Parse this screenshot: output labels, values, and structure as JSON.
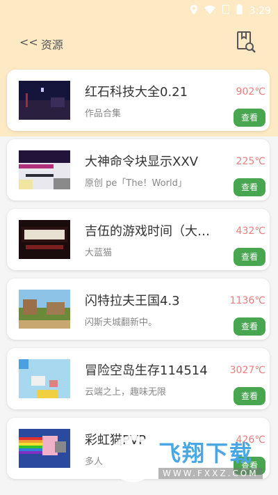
{
  "status": {
    "time": "3:29"
  },
  "header": {
    "back_arrows": "<<",
    "back_label": "资源"
  },
  "items": [
    {
      "title": "红石科技大全0.21",
      "subtitle": "作品合集",
      "temp": "902℃",
      "button": "查看"
    },
    {
      "title": "大神命令块显示XXV",
      "subtitle": "原创 pe「The！World」",
      "temp": "225℃",
      "button": "查看"
    },
    {
      "title": "吉伍的游戏时间（大…",
      "subtitle": "大蓝猫",
      "temp": "432℃",
      "button": "查看"
    },
    {
      "title": "闪特拉夫王国4.3",
      "subtitle": "闪斯夫城翻新中。",
      "temp": "1136℃",
      "button": "查看"
    },
    {
      "title": "冒险空岛生存114514",
      "subtitle": "云端之上，趣味无限",
      "temp": "3027℃",
      "button": "查看"
    },
    {
      "title": "彩虹猫PVP",
      "subtitle": "多人",
      "temp": "426℃",
      "button": "查看"
    }
  ],
  "watermark": {
    "brand": "飞翔下载",
    "url": "WWW.FXXZ.COM"
  }
}
